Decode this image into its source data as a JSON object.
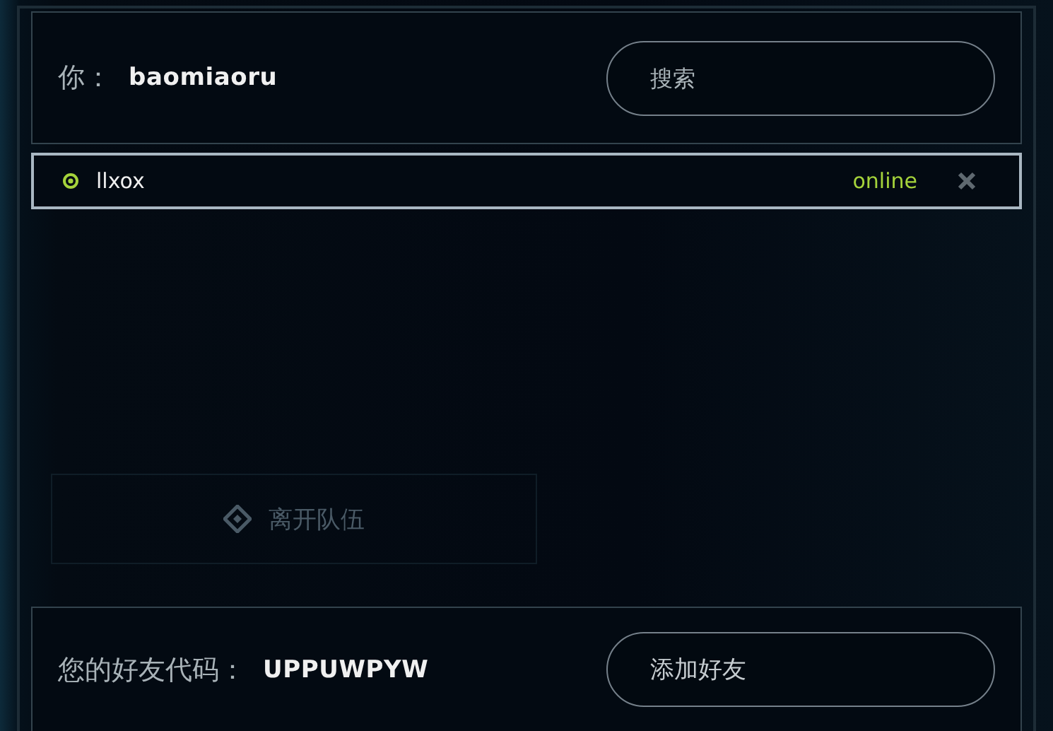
{
  "header": {
    "label": "你：",
    "username": "baomiaoru",
    "search": {
      "placeholder": "搜索"
    }
  },
  "friends": [
    {
      "name": "llxox",
      "status": "online",
      "online": true,
      "selected": true
    }
  ],
  "background_button": {
    "label": "离开队伍",
    "disabled": true
  },
  "footer": {
    "label": "您的好友代码：",
    "code": "UPPUWPYW",
    "button": "添加好友"
  }
}
